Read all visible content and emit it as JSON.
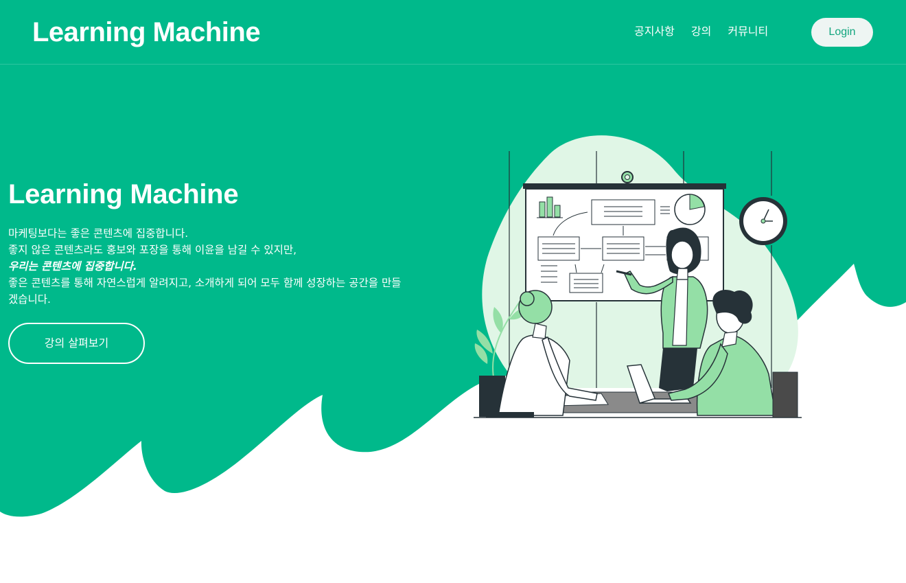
{
  "colors": {
    "brand": "#00b98b",
    "light_green": "#94dfa6",
    "pale_green": "#e0f6e6",
    "dark": "#263238",
    "button_bg": "#eef5f3",
    "button_text": "#12a57e"
  },
  "header": {
    "logo": "Learning Machine",
    "nav": [
      "공지사항",
      "강의",
      "커뮤니티"
    ],
    "login_label": "Login"
  },
  "hero": {
    "title": "Learning Machine",
    "lines": [
      "마케팅보다는 좋은 콘텐츠에 집중합니다.",
      "좋지 않은 콘텐츠라도 홍보와 포장을 통해 이윤을 남길 수 있지만,",
      "우리는 콘텐츠에 집중합니다.",
      "좋은 콘텐츠를 통해 자연스럽게 알려지고, 소개하게 되어 모두 함께 성장하는 공간을 만들",
      "겠습니다."
    ],
    "cta_label": "강의 살펴보기"
  },
  "illustration": {
    "icon": "team-meeting-presentation-illustration"
  }
}
